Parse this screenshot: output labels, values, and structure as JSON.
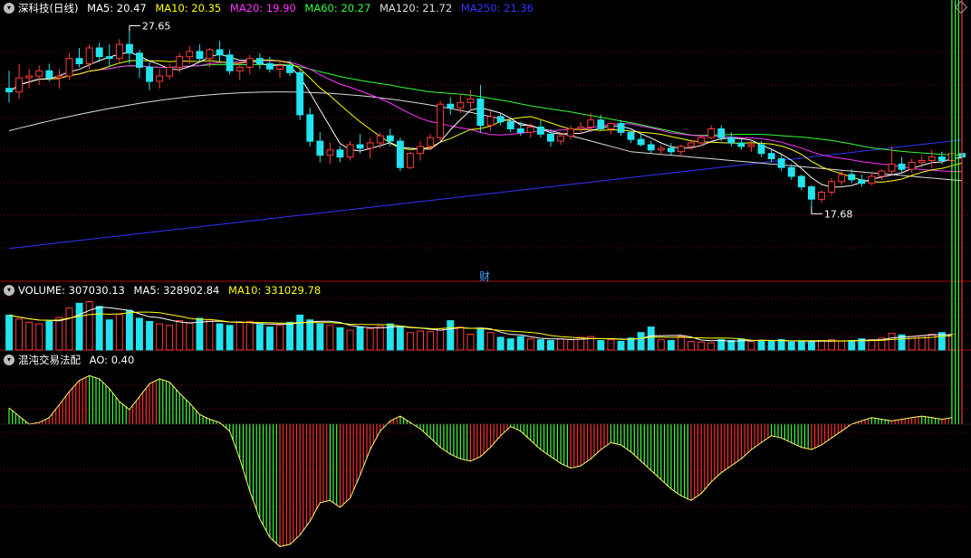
{
  "colors": {
    "bg": "#000000",
    "up": "#ff3b3b",
    "down": "#22e3ee",
    "ma5": "#ffffff",
    "ma10": "#ffff00",
    "ma20": "#ff33ff",
    "ma60": "#33ff33",
    "ma120": "#dddddd",
    "ma250": "#3333ff",
    "ao_up": "#ff2e2e",
    "ao_down": "#3cff3c",
    "divider": "#b30000",
    "grid": "#7a0000"
  },
  "main_header": {
    "stock": "深科技(日线)",
    "ma5": "MA5: 20.47",
    "ma10": "MA10: 20.35",
    "ma20": "MA20: 19.90",
    "ma60": "MA60: 20.27",
    "ma120": "MA120: 21.72",
    "ma250": "MA250: 21.36"
  },
  "volume_header": {
    "title": "VOLUME: 307030.13",
    "ma5": "MA5: 328902.84",
    "ma10": "MA10: 331029.78"
  },
  "ao_header": {
    "title": "混沌交易法配",
    "ao": "AO: 0.40"
  },
  "fin_marker": "财",
  "chart_data": [
    {
      "type": "candlestick",
      "name": "price",
      "annotations": [
        {
          "label": "27.65",
          "value": 27.65
        },
        {
          "label": "17.68",
          "value": 17.68
        }
      ],
      "ohlc": [
        [
          24.4,
          25.4,
          23.6,
          24.2
        ],
        [
          24.2,
          25.8,
          23.8,
          25.0
        ],
        [
          25.0,
          25.5,
          24.4,
          25.1
        ],
        [
          25.1,
          25.7,
          24.6,
          25.4
        ],
        [
          25.4,
          25.8,
          24.8,
          25.0
        ],
        [
          25.0,
          25.5,
          24.4,
          25.1
        ],
        [
          25.1,
          26.4,
          24.9,
          26.1
        ],
        [
          26.1,
          26.7,
          25.6,
          25.8
        ],
        [
          25.8,
          26.9,
          25.5,
          26.7
        ],
        [
          26.7,
          27.0,
          25.9,
          26.2
        ],
        [
          26.2,
          26.9,
          25.6,
          26.1
        ],
        [
          26.1,
          27.2,
          25.9,
          26.9
        ],
        [
          26.9,
          27.65,
          25.8,
          26.4
        ],
        [
          26.4,
          26.6,
          25.0,
          25.6
        ],
        [
          25.6,
          25.9,
          24.3,
          24.8
        ],
        [
          24.8,
          25.5,
          24.4,
          25.1
        ],
        [
          25.1,
          25.8,
          24.9,
          25.6
        ],
        [
          25.6,
          26.4,
          25.3,
          26.2
        ],
        [
          26.2,
          26.8,
          25.8,
          26.5
        ],
        [
          26.5,
          26.9,
          25.9,
          26.1
        ],
        [
          26.1,
          26.7,
          25.6,
          26.6
        ],
        [
          26.6,
          27.1,
          25.9,
          26.3
        ],
        [
          26.3,
          26.6,
          25.2,
          25.4
        ],
        [
          25.4,
          25.9,
          24.9,
          25.6
        ],
        [
          25.6,
          26.3,
          25.2,
          26.1
        ],
        [
          26.1,
          26.4,
          25.5,
          25.8
        ],
        [
          25.8,
          26.2,
          25.3,
          25.5
        ],
        [
          25.5,
          25.9,
          25.0,
          25.7
        ],
        [
          25.7,
          26.0,
          25.1,
          25.3
        ],
        [
          25.3,
          25.5,
          22.6,
          22.9
        ],
        [
          22.9,
          23.3,
          21.1,
          21.4
        ],
        [
          21.4,
          21.9,
          20.2,
          20.6
        ],
        [
          20.6,
          21.3,
          20.1,
          20.9
        ],
        [
          20.9,
          21.1,
          20.2,
          20.5
        ],
        [
          20.5,
          21.4,
          20.3,
          21.2
        ],
        [
          21.2,
          21.8,
          20.7,
          21.0
        ],
        [
          21.0,
          21.6,
          20.4,
          21.3
        ],
        [
          21.3,
          21.9,
          21.0,
          21.7
        ],
        [
          21.7,
          22.1,
          21.1,
          21.4
        ],
        [
          21.4,
          21.6,
          19.7,
          19.9
        ],
        [
          19.9,
          20.8,
          19.8,
          20.7
        ],
        [
          20.7,
          21.4,
          20.3,
          21.1
        ],
        [
          21.1,
          21.8,
          20.9,
          21.6
        ],
        [
          21.6,
          23.7,
          21.4,
          23.5
        ],
        [
          23.5,
          23.9,
          22.9,
          23.3
        ],
        [
          23.3,
          24.1,
          23.0,
          23.6
        ],
        [
          23.6,
          24.3,
          23.2,
          23.8
        ],
        [
          23.8,
          24.6,
          21.9,
          22.3
        ],
        [
          22.3,
          23.1,
          22.0,
          22.8
        ],
        [
          22.8,
          23.0,
          22.3,
          22.5
        ],
        [
          22.5,
          22.7,
          21.9,
          22.1
        ],
        [
          22.1,
          22.5,
          21.7,
          21.9
        ],
        [
          21.9,
          22.4,
          21.6,
          22.2
        ],
        [
          22.2,
          22.6,
          21.6,
          21.8
        ],
        [
          21.8,
          22.1,
          21.1,
          21.4
        ],
        [
          21.4,
          21.9,
          21.2,
          21.7
        ],
        [
          21.7,
          22.3,
          21.5,
          22.1
        ],
        [
          22.1,
          22.5,
          21.8,
          22.2
        ],
        [
          22.2,
          23.0,
          21.9,
          22.6
        ],
        [
          22.6,
          22.9,
          22.0,
          22.1
        ],
        [
          22.1,
          22.5,
          21.8,
          22.4
        ],
        [
          22.4,
          22.6,
          21.7,
          21.9
        ],
        [
          21.9,
          22.0,
          21.3,
          21.5
        ],
        [
          21.5,
          21.8,
          21.1,
          21.2
        ],
        [
          21.2,
          21.4,
          20.7,
          20.9
        ],
        [
          20.9,
          21.2,
          20.6,
          21.0
        ],
        [
          21.0,
          21.3,
          20.6,
          20.8
        ],
        [
          20.8,
          21.2,
          20.5,
          21.1
        ],
        [
          21.1,
          21.5,
          20.9,
          21.3
        ],
        [
          21.3,
          21.8,
          21.1,
          21.6
        ],
        [
          21.6,
          22.3,
          21.5,
          22.1
        ],
        [
          22.1,
          22.3,
          21.4,
          21.6
        ],
        [
          21.6,
          21.9,
          21.1,
          21.3
        ],
        [
          21.3,
          21.5,
          20.9,
          21.1
        ],
        [
          21.1,
          21.4,
          20.8,
          21.2
        ],
        [
          21.2,
          21.4,
          20.5,
          20.7
        ],
        [
          20.7,
          20.9,
          20.2,
          20.4
        ],
        [
          20.4,
          20.6,
          19.7,
          19.9
        ],
        [
          19.9,
          20.1,
          19.2,
          19.4
        ],
        [
          19.4,
          19.5,
          18.6,
          18.8
        ],
        [
          18.8,
          18.9,
          17.68,
          18.1
        ],
        [
          18.1,
          18.6,
          17.9,
          18.5
        ],
        [
          18.5,
          19.3,
          18.3,
          19.1
        ],
        [
          19.1,
          19.7,
          18.9,
          19.5
        ],
        [
          19.5,
          19.8,
          19.0,
          19.2
        ],
        [
          19.2,
          19.5,
          18.8,
          19.0
        ],
        [
          19.0,
          19.6,
          18.9,
          19.4
        ],
        [
          19.4,
          19.8,
          19.2,
          19.7
        ],
        [
          19.7,
          21.1,
          19.5,
          20.1
        ],
        [
          20.1,
          20.5,
          19.6,
          19.8
        ],
        [
          19.8,
          20.4,
          19.6,
          20.2
        ],
        [
          20.2,
          20.6,
          19.9,
          20.3
        ],
        [
          20.3,
          20.9,
          19.9,
          20.5
        ],
        [
          20.5,
          20.8,
          20.1,
          20.3
        ],
        [
          20.3,
          20.9,
          20.1,
          20.7
        ],
        [
          20.7,
          21.0,
          20.3,
          20.5
        ]
      ]
    },
    {
      "type": "bar",
      "name": "volume",
      "values": [
        44,
        39,
        35,
        33,
        36,
        41,
        53,
        59,
        61,
        55,
        38,
        45,
        50,
        40,
        36,
        33,
        31,
        37,
        34,
        40,
        38,
        33,
        31,
        35,
        36,
        32,
        29,
        31,
        35,
        44,
        38,
        33,
        31,
        28,
        25,
        29,
        27,
        30,
        33,
        29,
        22,
        24,
        23,
        27,
        37,
        29,
        20,
        26,
        22,
        16,
        14,
        17,
        14,
        13,
        12,
        14,
        13,
        16,
        17,
        12,
        13,
        11,
        15,
        22,
        29,
        13,
        12,
        17,
        11,
        10,
        9,
        13,
        12,
        14,
        11,
        12,
        11,
        13,
        10,
        11,
        10,
        12,
        13,
        11,
        12,
        14,
        13,
        15,
        21,
        19,
        17,
        18,
        20,
        22,
        20
      ]
    },
    {
      "type": "bar",
      "name": "AO",
      "values": [
        1.0,
        0.5,
        0.0,
        0.1,
        0.4,
        1.2,
        2.0,
        2.7,
        3.0,
        2.8,
        2.2,
        1.4,
        0.9,
        1.7,
        2.5,
        2.8,
        2.6,
        1.9,
        1.3,
        0.6,
        0.3,
        0.1,
        -0.3,
        -1.5,
        -2.9,
        -4.1,
        -4.9,
        -5.3,
        -5.2,
        -4.8,
        -4.2,
        -3.4,
        -3.3,
        -3.6,
        -3.2,
        -2.2,
        -1.1,
        -0.3,
        0.2,
        0.5,
        0.1,
        -0.2,
        -0.6,
        -1.0,
        -1.3,
        -1.5,
        -1.6,
        -1.4,
        -1.0,
        -0.5,
        -0.1,
        -0.3,
        -0.7,
        -1.1,
        -1.4,
        -1.7,
        -1.9,
        -1.8,
        -1.5,
        -1.1,
        -0.8,
        -0.9,
        -1.2,
        -1.6,
        -2.0,
        -2.4,
        -2.8,
        -3.1,
        -3.3,
        -3.0,
        -2.5,
        -2.1,
        -1.8,
        -1.5,
        -1.1,
        -0.8,
        -0.5,
        -0.6,
        -0.8,
        -1.0,
        -1.1,
        -0.9,
        -0.6,
        -0.3,
        0.0,
        0.2,
        0.4,
        0.3,
        0.2,
        0.3,
        0.4,
        0.5,
        0.4,
        0.3,
        0.4
      ]
    }
  ]
}
